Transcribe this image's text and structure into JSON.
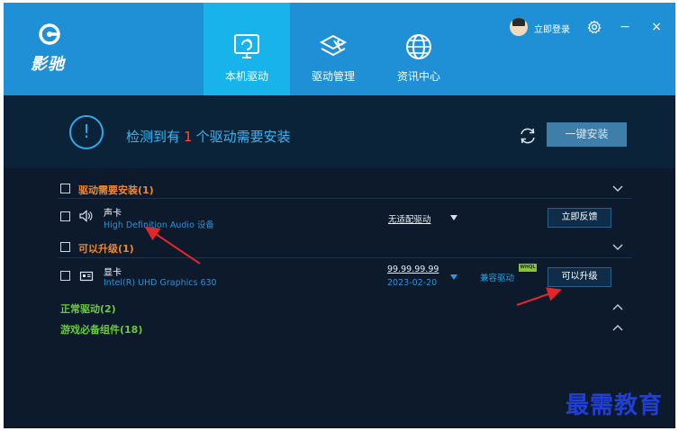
{
  "app": {
    "logo_text": "影驰",
    "accent": "#1f8fd6",
    "active_tab": "#18b3ea"
  },
  "nav": {
    "tabs": [
      {
        "label": "本机驱动",
        "icon": "monitor-icon"
      },
      {
        "label": "驱动管理",
        "icon": "wrench-icon"
      },
      {
        "label": "资讯中心",
        "icon": "globe-icon"
      }
    ]
  },
  "header": {
    "login_label": "立即登录",
    "settings_icon": "gear-icon",
    "minimize": "−",
    "close": "×"
  },
  "banner": {
    "text_prefix": "检测到有",
    "count": "1",
    "text_suffix": "个驱动需要安装",
    "install_button": "一键安装"
  },
  "sections": {
    "need_install": {
      "title": "驱动需要安装(1)",
      "device": {
        "name": "声卡",
        "model": "High Definition Audio 设备",
        "driver_status": "无适配驱动",
        "button": "立即反馈"
      }
    },
    "upgradable": {
      "title": "可以升级(1)",
      "device": {
        "name": "显卡",
        "model": "Intel(R) UHD Graphics 630",
        "version": "99.99.99.99",
        "date": "2023-02-20",
        "compat": "兼容驱动",
        "badge": "WHQL",
        "button": "可以升级"
      }
    },
    "normal": {
      "title": "正常驱动(2)"
    },
    "game": {
      "title": "游戏必备组件(18)"
    }
  },
  "watermark": "最需教育",
  "colors": {
    "orange": "#f0882b",
    "green": "#69c93c",
    "link": "#2f8fd1",
    "arrow": "#e3262b"
  }
}
